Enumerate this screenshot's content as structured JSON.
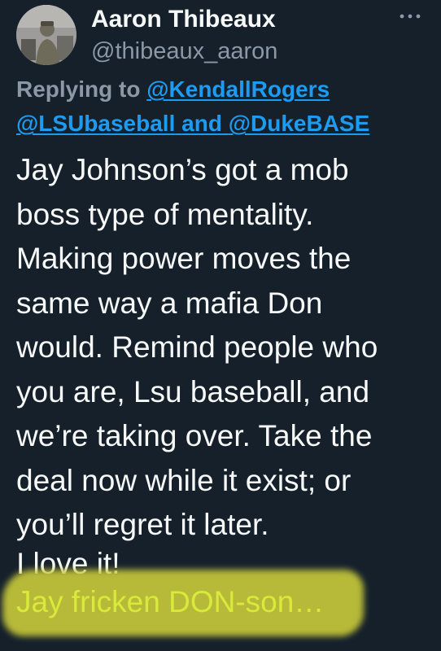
{
  "author": {
    "display_name": "Aaron Thibeaux",
    "handle": "@thibeaux_aaron",
    "avatar_icon": "profile-photo"
  },
  "more_icon": "more-horizontal-icon",
  "reply": {
    "prefix": "Replying to",
    "mention_1": "@KendallRogers",
    "mention_2": "@LSUbaseball",
    "conjunction": "and",
    "mention_3": "@DukeBASE"
  },
  "tweet": {
    "lines": [
      "Jay Johnson’s got a mob",
      "boss type of mentality.",
      "Making power moves the",
      "same way a mafia Don",
      "would. Remind people who",
      "you are, Lsu baseball, and",
      "we’re taking over. Take the",
      "deal now while it exist; or",
      "you’ll regret it later."
    ],
    "love_line": "I love it!",
    "highlighted_line": "Jay fricken DON-son…"
  },
  "colors": {
    "background": "#15202b",
    "text": "#f7f9f9",
    "secondary": "#8b98a5",
    "link": "#1d9bf0",
    "highlight": "#c5c73a"
  }
}
